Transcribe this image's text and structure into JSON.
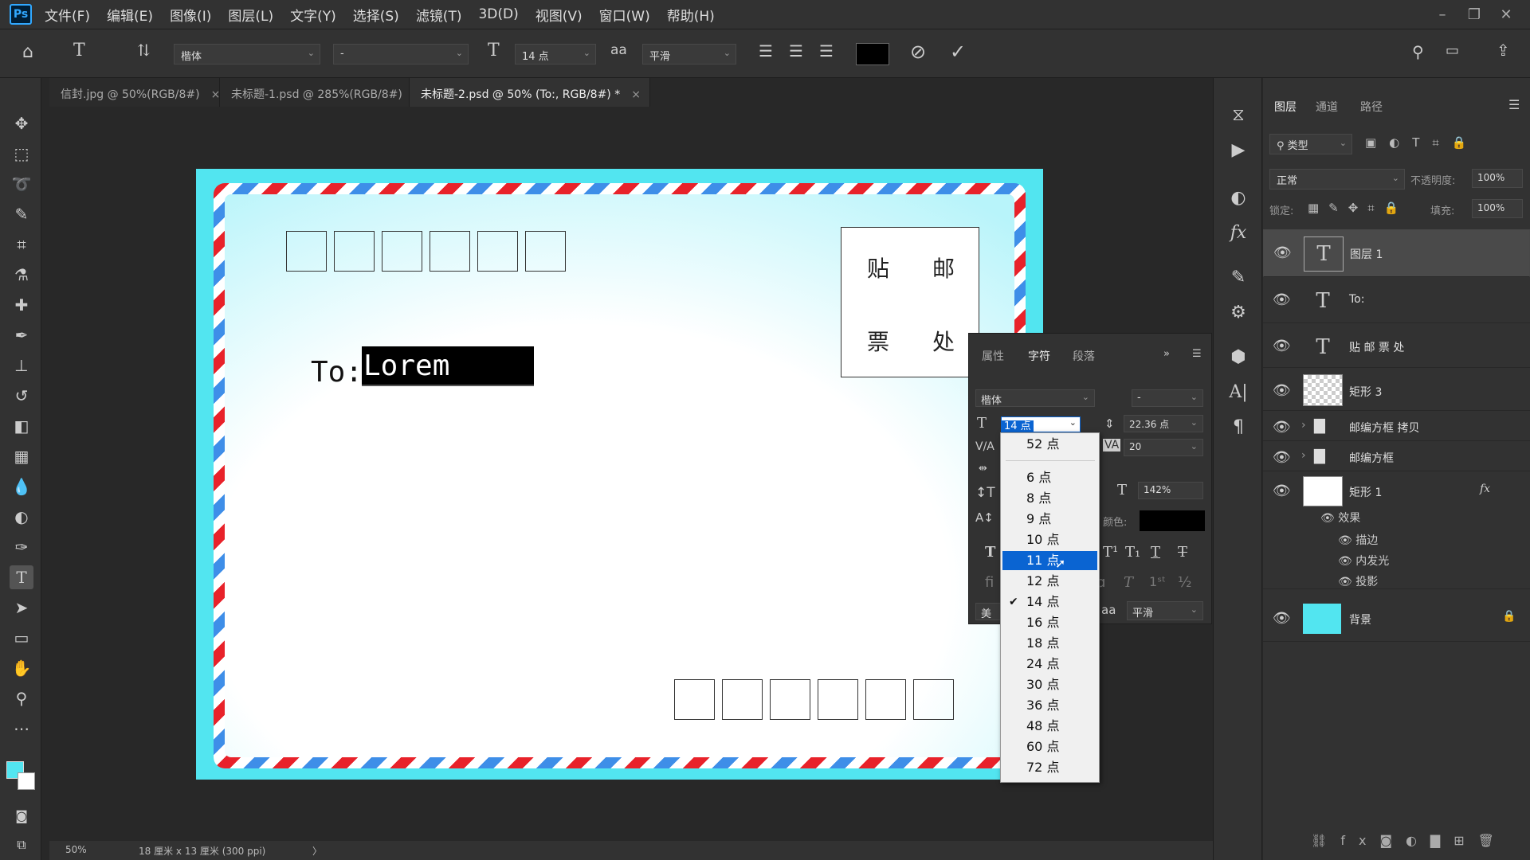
{
  "app": {
    "logo": "Ps"
  },
  "menu": [
    "文件(F)",
    "编辑(E)",
    "图像(I)",
    "图层(L)",
    "文字(Y)",
    "选择(S)",
    "滤镜(T)",
    "3D(D)",
    "视图(V)",
    "窗口(W)",
    "帮助(H)"
  ],
  "options": {
    "font_family": "楷体",
    "font_style": "-",
    "font_size": "14 点",
    "antialias_icon": "aa",
    "antialias": "平滑"
  },
  "tabs": [
    {
      "label": "信封.jpg @ 50%(RGB/8#)",
      "close": "×"
    },
    {
      "label": "未标题-1.psd @ 285%(RGB/8#)",
      "close": "×"
    },
    {
      "label": "未标题-2.psd @ 50% (To:, RGB/8#) *",
      "close": "×"
    }
  ],
  "canvas": {
    "to_label": "To:",
    "to_text": "Lorem Ipsum",
    "stamp": [
      "贴",
      "邮",
      "票",
      "处"
    ]
  },
  "status": {
    "zoom": "50%",
    "doc_info": "18 厘米 x 13 厘米 (300 ppi)",
    "arrow": "〉"
  },
  "char_panel": {
    "tabs": [
      "属性",
      "字符",
      "段落"
    ],
    "font_family": "楷体",
    "font_style": "-",
    "size_value": "14 点",
    "leading": "22.36 点",
    "tracking": "20",
    "scale": "142%",
    "color_label": "颜色:",
    "language": "美",
    "aa_icon": "aa",
    "antialias": "平滑"
  },
  "size_dropdown": {
    "items": [
      "52 点",
      "6 点",
      "8 点",
      "9 点",
      "10 点",
      "11 点",
      "12 点",
      "14 点",
      "16 点",
      "18 点",
      "24 点",
      "30 点",
      "36 点",
      "48 点",
      "60 点",
      "72 点"
    ],
    "highlighted": "11 点",
    "checked": "14 点"
  },
  "layers_panel": {
    "tabs": [
      "图层",
      "通道",
      "路径"
    ],
    "filter_placeholder": "类型",
    "blend_mode": "正常",
    "opacity_label": "不透明度:",
    "opacity": "100%",
    "lock_label": "锁定:",
    "fill_label": "填充:",
    "fill": "100%",
    "layers": [
      {
        "name": "图层 1",
        "kind": "text"
      },
      {
        "name": "To:",
        "kind": "text"
      },
      {
        "name": "贴 邮 票 处",
        "kind": "text"
      },
      {
        "name": "矩形 3",
        "kind": "shape"
      },
      {
        "name": "邮编方框 拷贝",
        "kind": "group"
      },
      {
        "name": "邮编方框",
        "kind": "group"
      },
      {
        "name": "矩形 1",
        "kind": "shape",
        "fx": "fx"
      },
      {
        "name": "背景",
        "kind": "fill"
      }
    ],
    "effects_label": "效果",
    "effects": [
      "描边",
      "内发光",
      "投影"
    ]
  },
  "colors": {
    "accent": "#31a8ff",
    "envelope": "#52e5f0",
    "highlight": "#0a64d2"
  }
}
